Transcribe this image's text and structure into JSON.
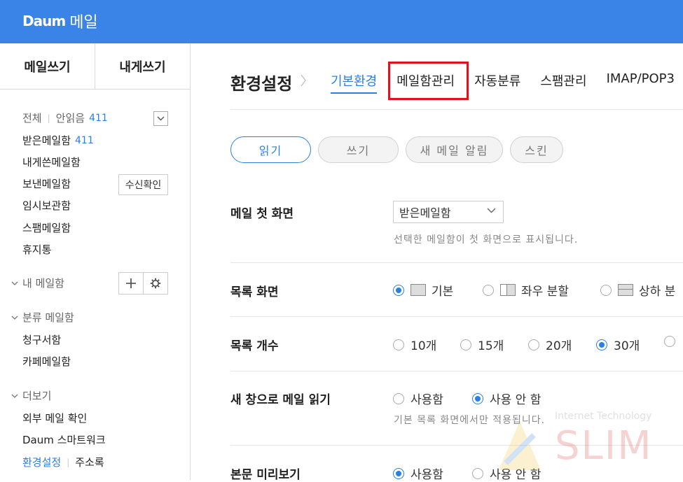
{
  "header": {
    "brand": "Daum",
    "app_name": "메일"
  },
  "sidebar": {
    "compose_label": "메일쓰기",
    "self_compose_label": "내게쓰기",
    "all_label": "전체",
    "unread_label": "안읽음",
    "unread_count": "411",
    "folders": [
      {
        "label": "받은메일함",
        "count": "411"
      },
      {
        "label": "내게쓴메일함",
        "count": ""
      },
      {
        "label": "보낸메일함",
        "count": ""
      },
      {
        "label": "임시보관함",
        "count": ""
      },
      {
        "label": "스팸메일함",
        "count": ""
      },
      {
        "label": "휴지통",
        "count": ""
      }
    ],
    "read_check_label": "수신확인",
    "my_folders_label": "내 메일함",
    "category_label": "분류 메일함",
    "category_items": [
      "청구서함",
      "카페메일함"
    ],
    "more_label": "더보기",
    "more_items": [
      "외부 메일 확인",
      "Daum 스마트워크"
    ],
    "settings_label": "환경설정",
    "contacts_label": "주소록"
  },
  "main": {
    "title": "환경설정",
    "tabs": [
      "기본환경",
      "메일함관리",
      "자동분류",
      "스팸관리",
      "IMAP/POP3"
    ],
    "subtabs": [
      "읽기",
      "쓰기",
      "새 메일 알림",
      "스킨"
    ],
    "first_screen": {
      "label": "메일 첫 화면",
      "selected": "받은메일함",
      "hint": "선택한 메일함이 첫 화면으로 표시됩니다."
    },
    "list_view": {
      "label": "목록 화면",
      "options": [
        "기본",
        "좌우 분할",
        "상하 분"
      ]
    },
    "list_count": {
      "label": "목록 개수",
      "options": [
        "10개",
        "15개",
        "20개",
        "30개"
      ]
    },
    "new_window": {
      "label": "새 창으로 메일 읽기",
      "options": [
        "사용함",
        "사용 안 함"
      ],
      "hint": "기본 목록 화면에서만 적용됩니다."
    },
    "preview": {
      "label": "본문 미리보기",
      "options": [
        "사용함",
        "사용 안 함"
      ]
    }
  },
  "watermark": {
    "line1": "Internet Technology",
    "line2": "SLIM"
  },
  "colors": {
    "brand": "#3a84e8",
    "accent": "#2a7fe0",
    "highlight": "#e0121f"
  }
}
